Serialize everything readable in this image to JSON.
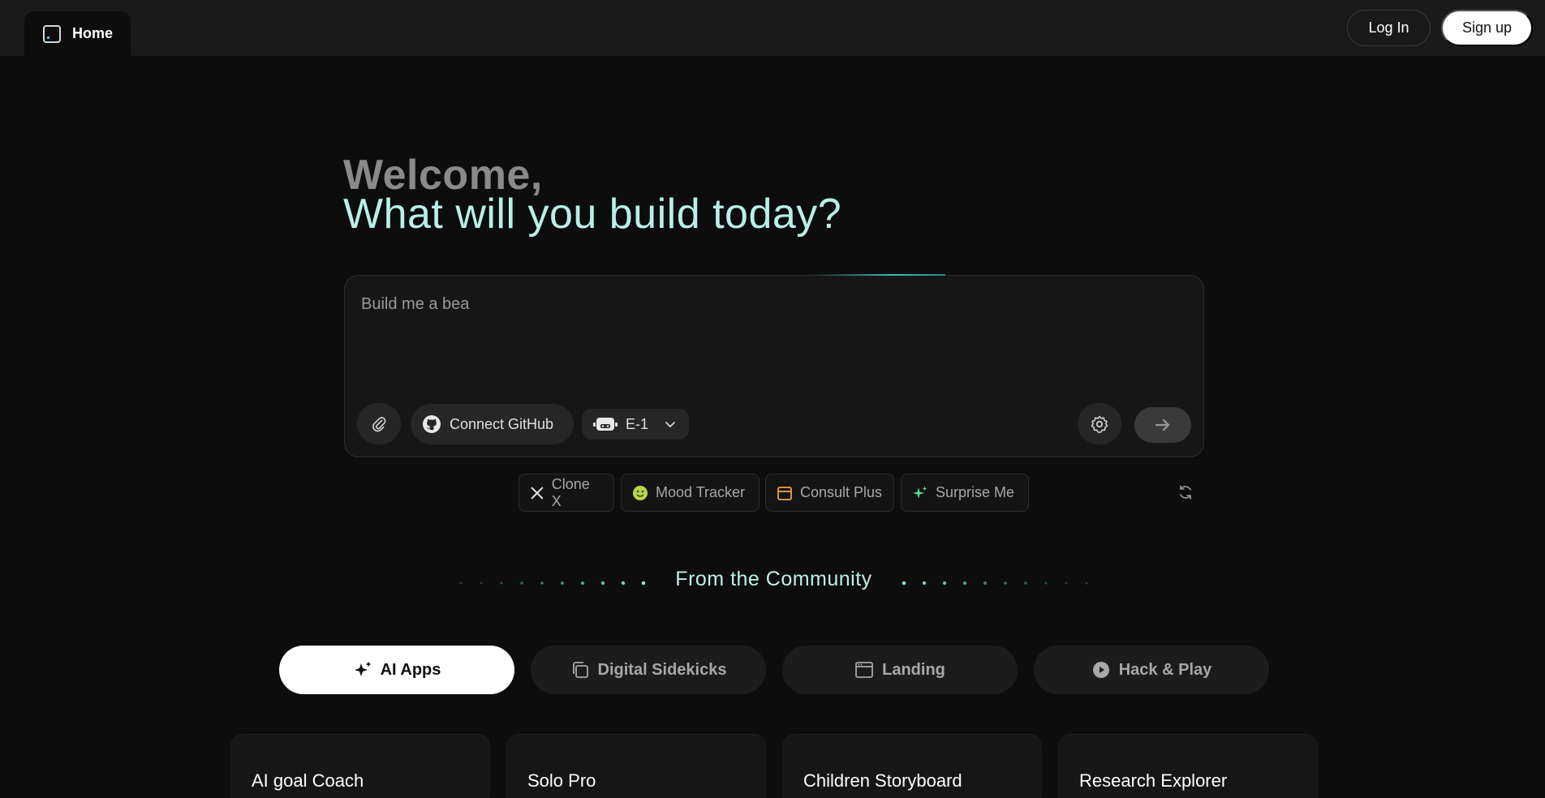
{
  "topbar": {
    "home_label": "Home",
    "login_label": "Log In",
    "signup_label": "Sign up"
  },
  "hero": {
    "welcome": "Welcome,",
    "question": "What will you build today?"
  },
  "prompt": {
    "value": "Build me a bea",
    "attach_icon": "paperclip-icon",
    "github_label": "Connect GitHub",
    "agent_label": "E-1",
    "settings_icon": "gear-icon",
    "send_icon": "arrow-right-icon"
  },
  "suggestions": [
    {
      "label": "Clone X",
      "icon": "x-logo-icon"
    },
    {
      "label": "Mood Tracker",
      "icon": "smiley-icon"
    },
    {
      "label": "Consult Plus",
      "icon": "calendar-icon"
    },
    {
      "label": "Surprise Me",
      "icon": "sparkle-icon"
    }
  ],
  "community": {
    "title": "From the Community"
  },
  "categories": [
    {
      "label": "AI Apps",
      "active": true
    },
    {
      "label": "Digital Sidekicks",
      "active": false
    },
    {
      "label": "Landing",
      "active": false
    },
    {
      "label": "Hack & Play",
      "active": false
    }
  ],
  "cards": [
    {
      "title": "AI goal Coach"
    },
    {
      "title": "Solo Pro"
    },
    {
      "title": "Children Storyboard"
    },
    {
      "title": "Research Explorer"
    }
  ],
  "colors": {
    "accent": "#b8f0e8",
    "background": "#0d0d0d",
    "topbar": "#1a1a1a"
  }
}
